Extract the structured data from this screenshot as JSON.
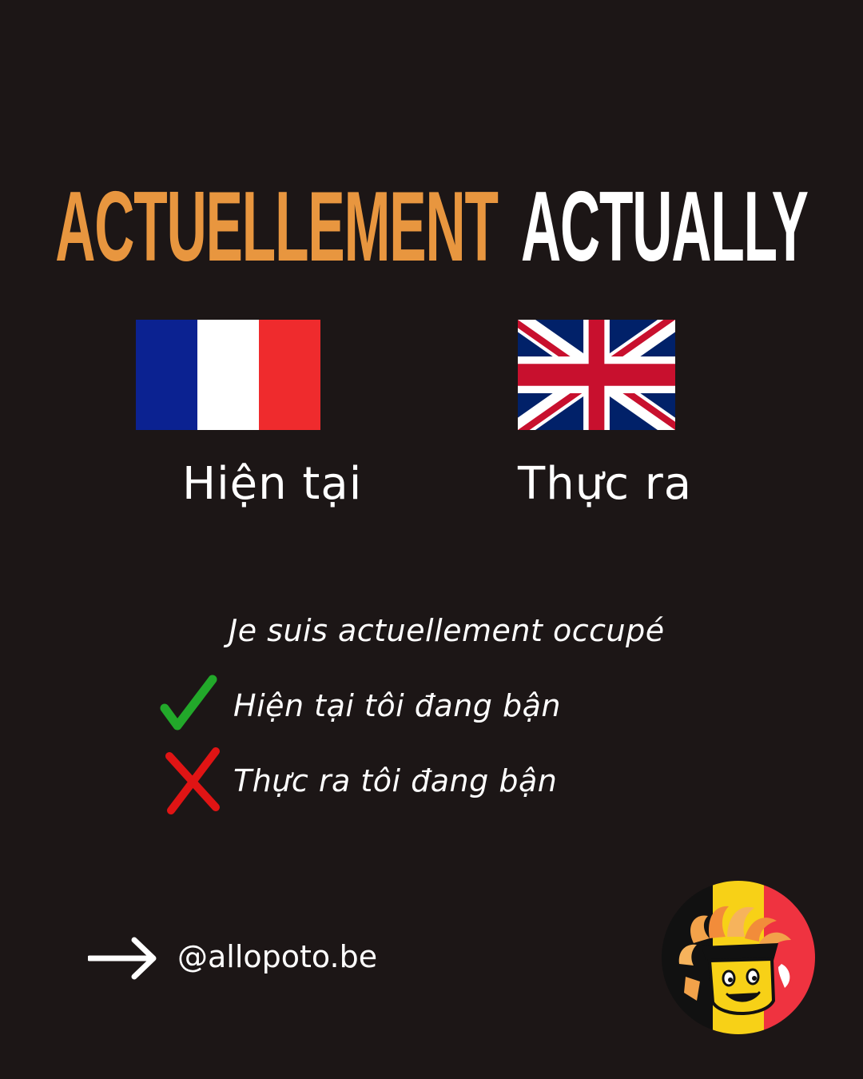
{
  "title": {
    "french_word": "ACTUELLEMENT",
    "english_word": "ACTUALLY"
  },
  "labels": {
    "french_meaning": "Hiện tại",
    "english_meaning": "Thực ra"
  },
  "example": {
    "french_sentence": "Je suis actuellement occupé",
    "correct_translation": "Hiện tại tôi đang bận",
    "wrong_translation": "Thực ra tôi đang bận"
  },
  "footer": {
    "handle": "@allopoto.be"
  },
  "icons": {
    "french": "france-flag-icon",
    "english": "uk-flag-icon",
    "correct": "check-icon",
    "wrong": "cross-icon",
    "arrow": "arrow-right-icon",
    "logo": "belgian-character-logo"
  },
  "colors": {
    "background": "#1c1616",
    "french_title": "#e8963f",
    "english_title": "#ffffff",
    "check": "#22a82a",
    "cross": "#e01414"
  }
}
